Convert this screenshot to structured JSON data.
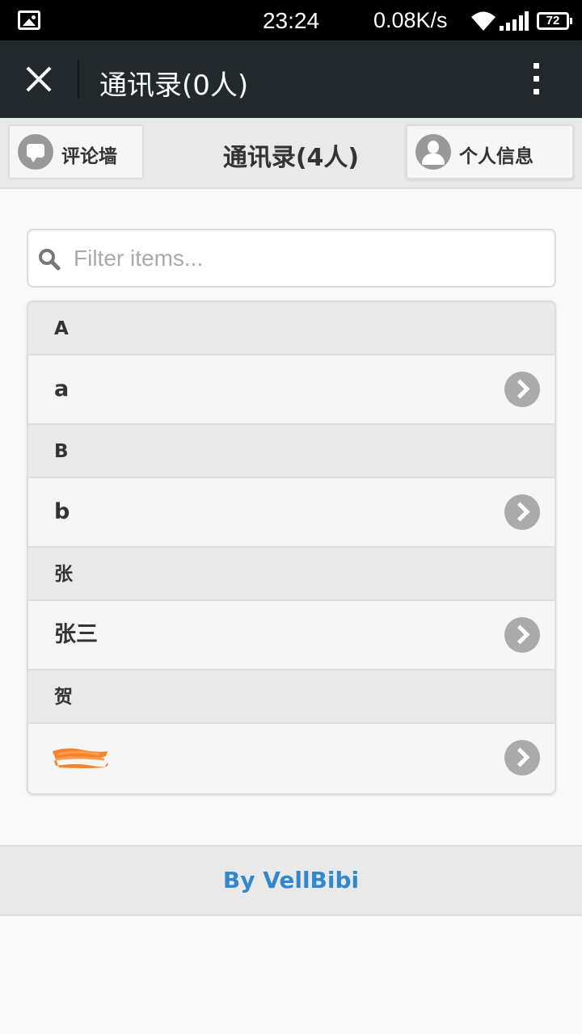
{
  "status_bar": {
    "time": "23:24",
    "net_speed": "0.08K/s",
    "battery": "72"
  },
  "title_bar": {
    "title": "通讯录(0人)"
  },
  "header": {
    "title": "通讯录(4人)",
    "left_button": "评论墙",
    "right_button": "个人信息"
  },
  "search": {
    "placeholder": "Filter items..."
  },
  "list": {
    "groups": [
      {
        "divider": "A",
        "item": "a"
      },
      {
        "divider": "B",
        "item": "b"
      },
      {
        "divider": "张",
        "item": "张三"
      },
      {
        "divider": "贺",
        "item": ""
      }
    ]
  },
  "footer": {
    "text": "By VellBibi"
  },
  "colors": {
    "accent": "#3388cc",
    "title_bar_bg": "#22292c",
    "redaction": "#f47c20"
  }
}
